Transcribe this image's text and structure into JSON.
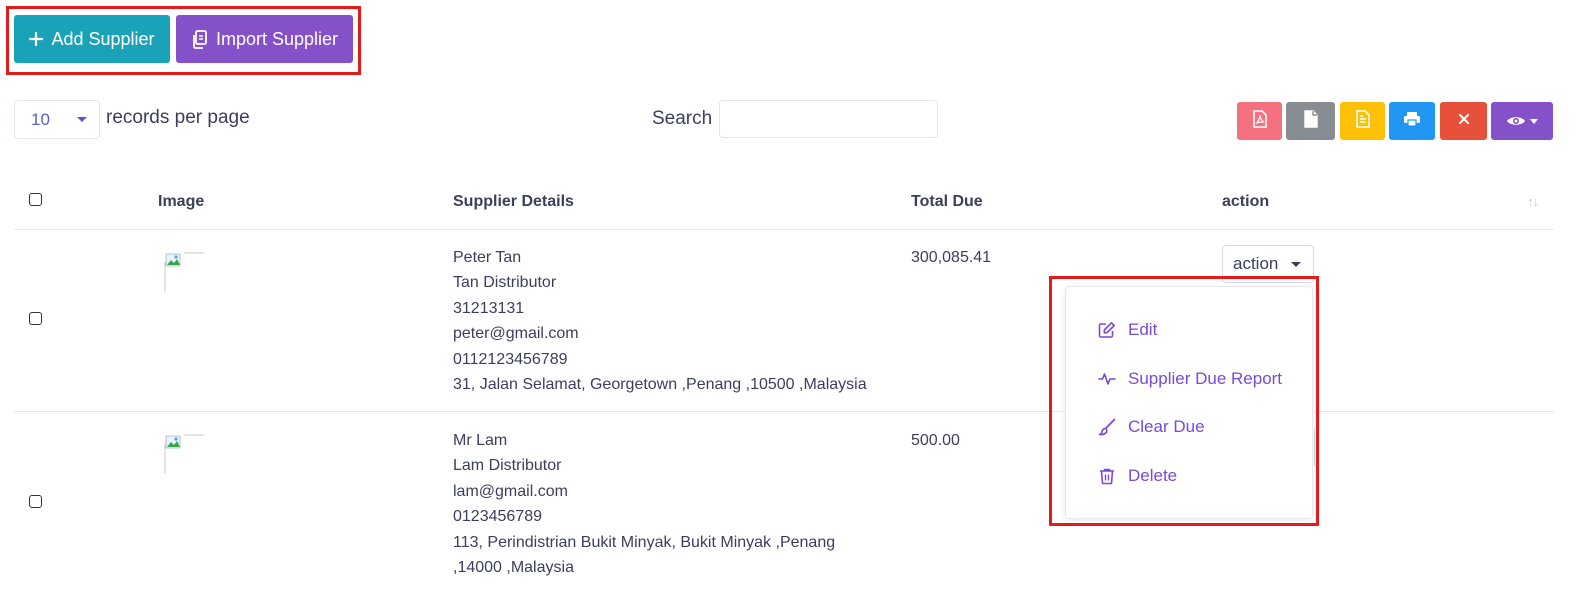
{
  "toolbar": {
    "add_supplier_label": "Add Supplier",
    "import_supplier_label": "Import Supplier"
  },
  "length": {
    "value": "10",
    "suffix": "records per page"
  },
  "search": {
    "label": "Search",
    "value": "",
    "placeholder": ""
  },
  "export_buttons": [
    {
      "icon": "pdf-icon",
      "color": "#f5707e"
    },
    {
      "icon": "file-icon",
      "color": "#878d93"
    },
    {
      "icon": "excel-icon",
      "color": "#ffc107"
    },
    {
      "icon": "print-icon",
      "color": "#2196f3"
    },
    {
      "icon": "close-icon",
      "color": "#e7513b"
    },
    {
      "icon": "eye-icon",
      "color": "#8451c8"
    }
  ],
  "table": {
    "columns": [
      "Image",
      "Supplier Details",
      "Total Due",
      "action"
    ],
    "rows": [
      {
        "details": [
          "Peter Tan",
          "Tan Distributor",
          "31213131",
          "peter@gmail.com",
          "0112123456789",
          "31, Jalan Selamat, Georgetown ,Penang ,10500 ,Malaysia"
        ],
        "total_due": "300,085.41",
        "action_label": "action"
      },
      {
        "details": [
          "Mr Lam",
          "Lam Distributor",
          "lam@gmail.com",
          "0123456789",
          "113, Perindistrian Bukit Minyak, Bukit Minyak ,Penang",
          ",14000 ,Malaysia"
        ],
        "total_due": "500.00",
        "action_label": "action"
      }
    ]
  },
  "action_menu": {
    "items": [
      {
        "label": "Edit",
        "icon": "edit-icon"
      },
      {
        "label": "Supplier Due Report",
        "icon": "activity-icon"
      },
      {
        "label": "Clear Due",
        "icon": "brush-icon"
      },
      {
        "label": "Delete",
        "icon": "trash-icon"
      }
    ]
  },
  "colors": {
    "accent": "#8451c8",
    "teal": "#1aa3b8",
    "highlight": "#e41b1b",
    "menu_text": "#7a49d6"
  }
}
